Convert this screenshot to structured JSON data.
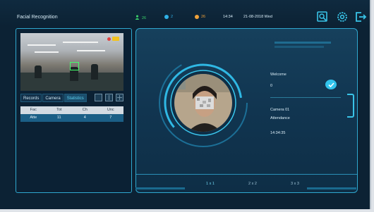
{
  "header": {
    "title": "Facial Recognition",
    "stat_green": "26",
    "stat_blue": "2",
    "stat_orange": "26",
    "time": "14:34",
    "date": "21-08-2018 Wed"
  },
  "colors": {
    "accent": "#32c4ec",
    "green": "#3ad06a",
    "blue": "#2fb2e8",
    "orange": "#f0a23a"
  },
  "left_panel": {
    "tabs": [
      "Records",
      "Camera",
      "Statistics"
    ],
    "table": {
      "headers": [
        "Fac",
        "Tot",
        "Ch",
        "Unc"
      ],
      "rows": [
        [
          "Atte",
          "11",
          "4",
          "7"
        ]
      ]
    }
  },
  "main": {
    "welcome_label": "Welcome",
    "welcome_value": "0",
    "camera": "Camera 01",
    "event": "Attendance",
    "time": "14:34:35",
    "page_options": [
      "1 x 1",
      "2 x 2",
      "3 x 3"
    ]
  }
}
